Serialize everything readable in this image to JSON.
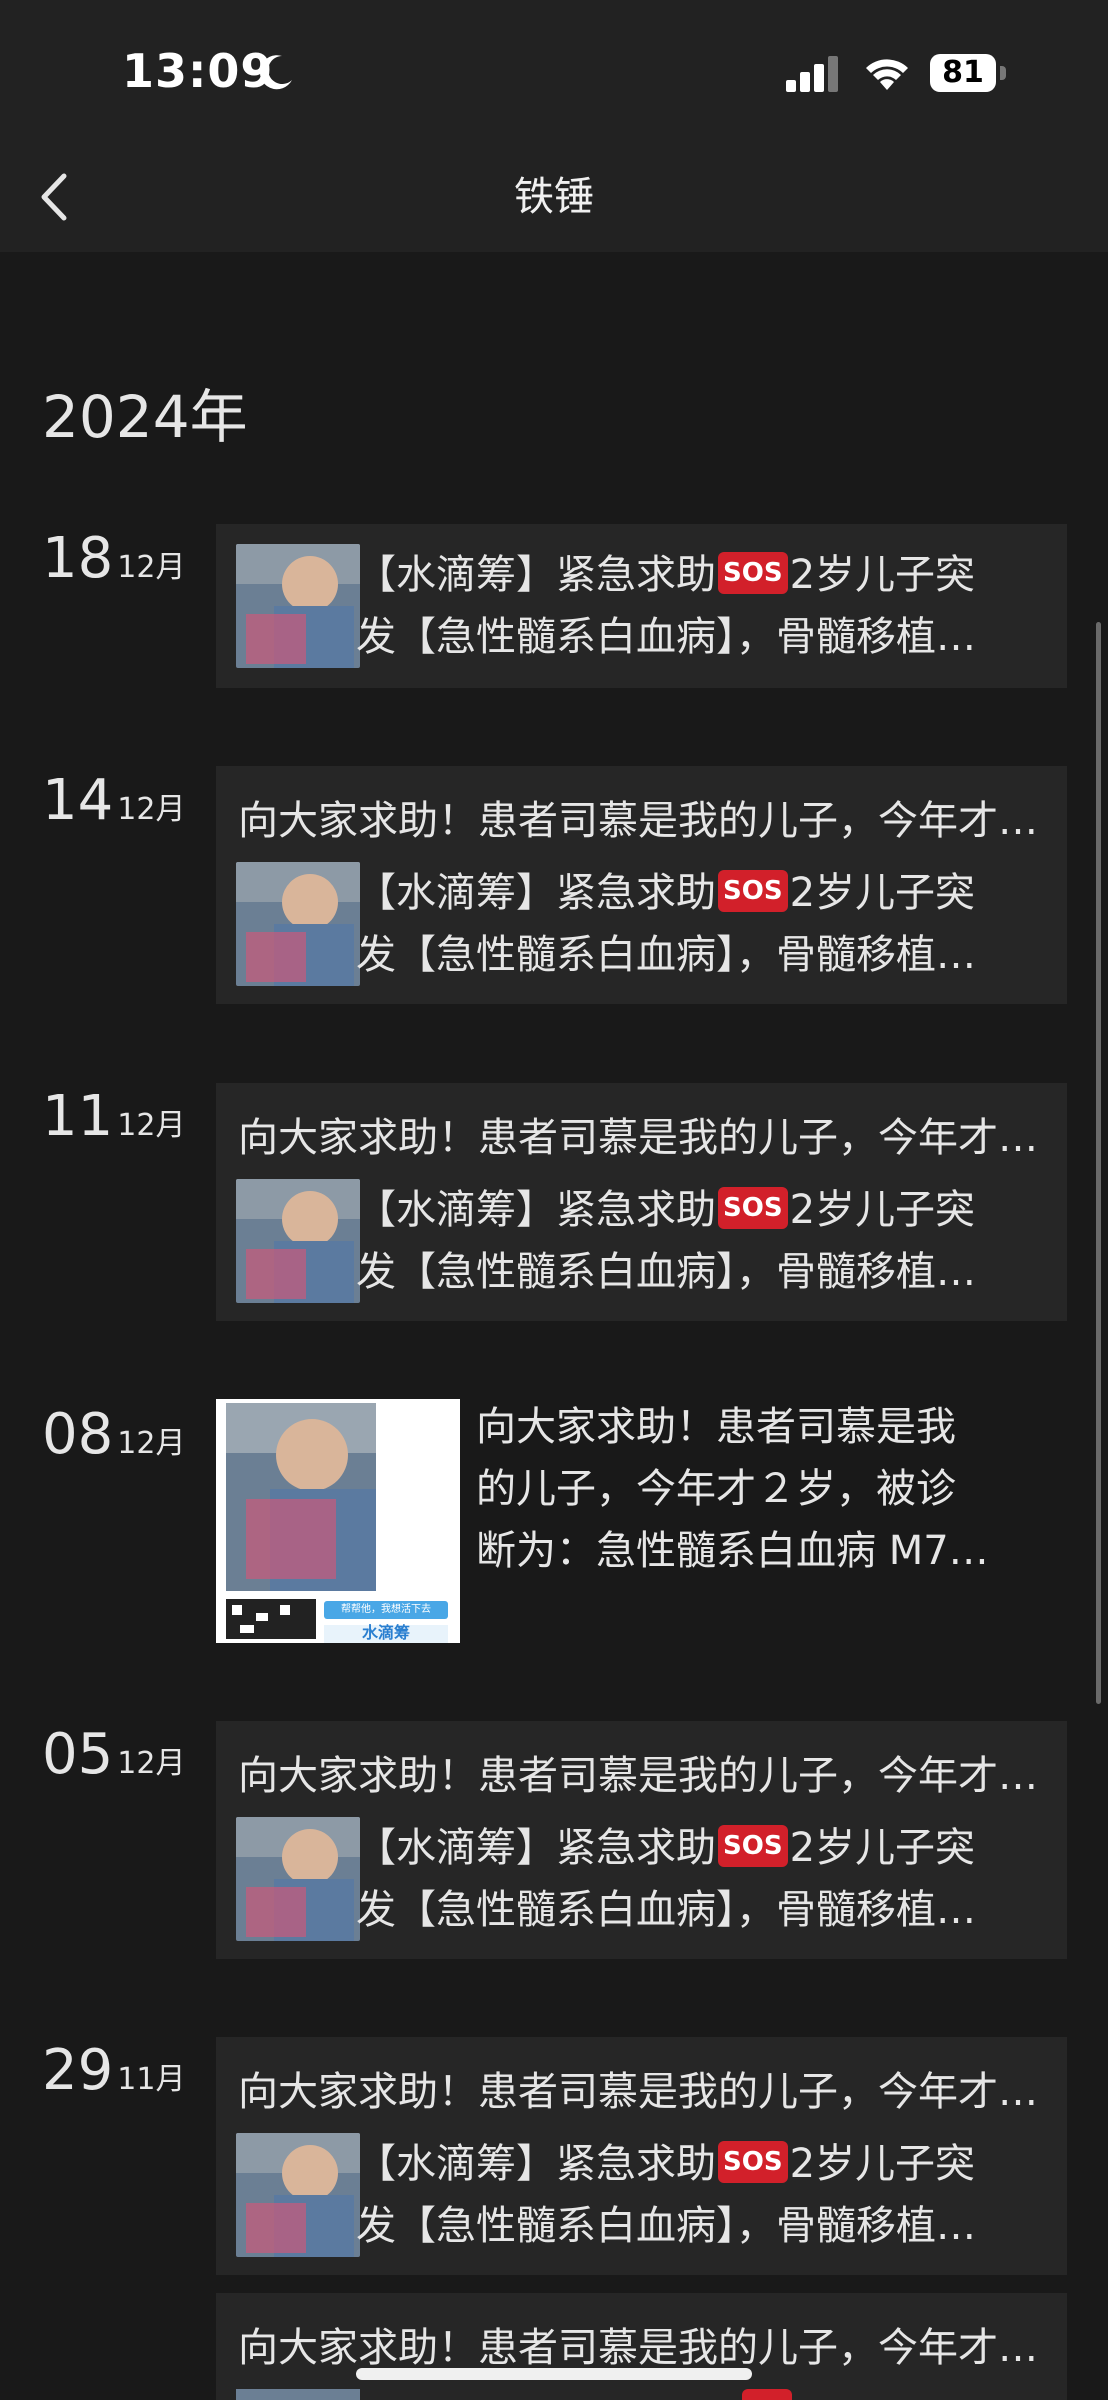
{
  "status_bar": {
    "time": "13:09",
    "battery": "81"
  },
  "header": {
    "title": "铁锤"
  },
  "year_label": "2024年",
  "share": {
    "line1_pre": "【水滴筹】紧急求助",
    "sos": "SOS",
    "line1_post": "2岁儿子突",
    "line2": "发【急性髓系白血病】，骨髓移植…",
    "post_text": "向大家求助！患者司慕是我的儿子，今年才2岁，被诊断为：急性髓系白血病M7…"
  },
  "entries": [
    {
      "day": "18",
      "month": "12月"
    },
    {
      "day": "14",
      "month": "12月"
    },
    {
      "day": "11",
      "month": "12月"
    },
    {
      "day": "08",
      "month": "12月",
      "lines": [
        "向大家求助！患者司慕是我",
        "的儿子，今年才２岁，被诊",
        "断为：急性髓系白血病 M7…"
      ],
      "poster_button": "帮帮他，我想活下去",
      "poster_brand": "水滴筹"
    },
    {
      "day": "05",
      "month": "12月"
    },
    {
      "day": "29",
      "month": "11月"
    }
  ],
  "colors": {
    "background": "#191919",
    "card": "#262626",
    "sos": "#d2202a"
  },
  "icons": [
    "moon-icon",
    "signal-icon",
    "wifi-icon",
    "back-chevron-icon",
    "thumbnail-image"
  ]
}
